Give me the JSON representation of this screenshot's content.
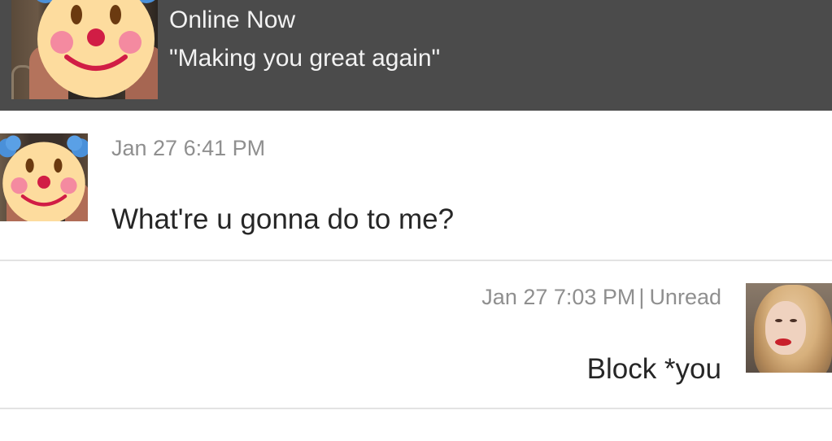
{
  "header": {
    "status": "Online Now",
    "tagline": "\"Making you great again\"",
    "avatar_icon": "clown-face-icon"
  },
  "messages": [
    {
      "direction": "received",
      "time": "Jan 27 6:41 PM",
      "text": "What're u gonna do to me?",
      "avatar_icon": "clown-face-icon"
    },
    {
      "direction": "sent",
      "time": "Jan 27 7:03 PM",
      "separator": "|",
      "status": "Unread",
      "text": "Block *you"
    }
  ],
  "colors": {
    "header_bg": "#4b4b4b",
    "header_text": "#f2f2f2",
    "timestamp": "#8f8f8f",
    "message_text": "#262626",
    "divider": "#e3e3e3"
  }
}
